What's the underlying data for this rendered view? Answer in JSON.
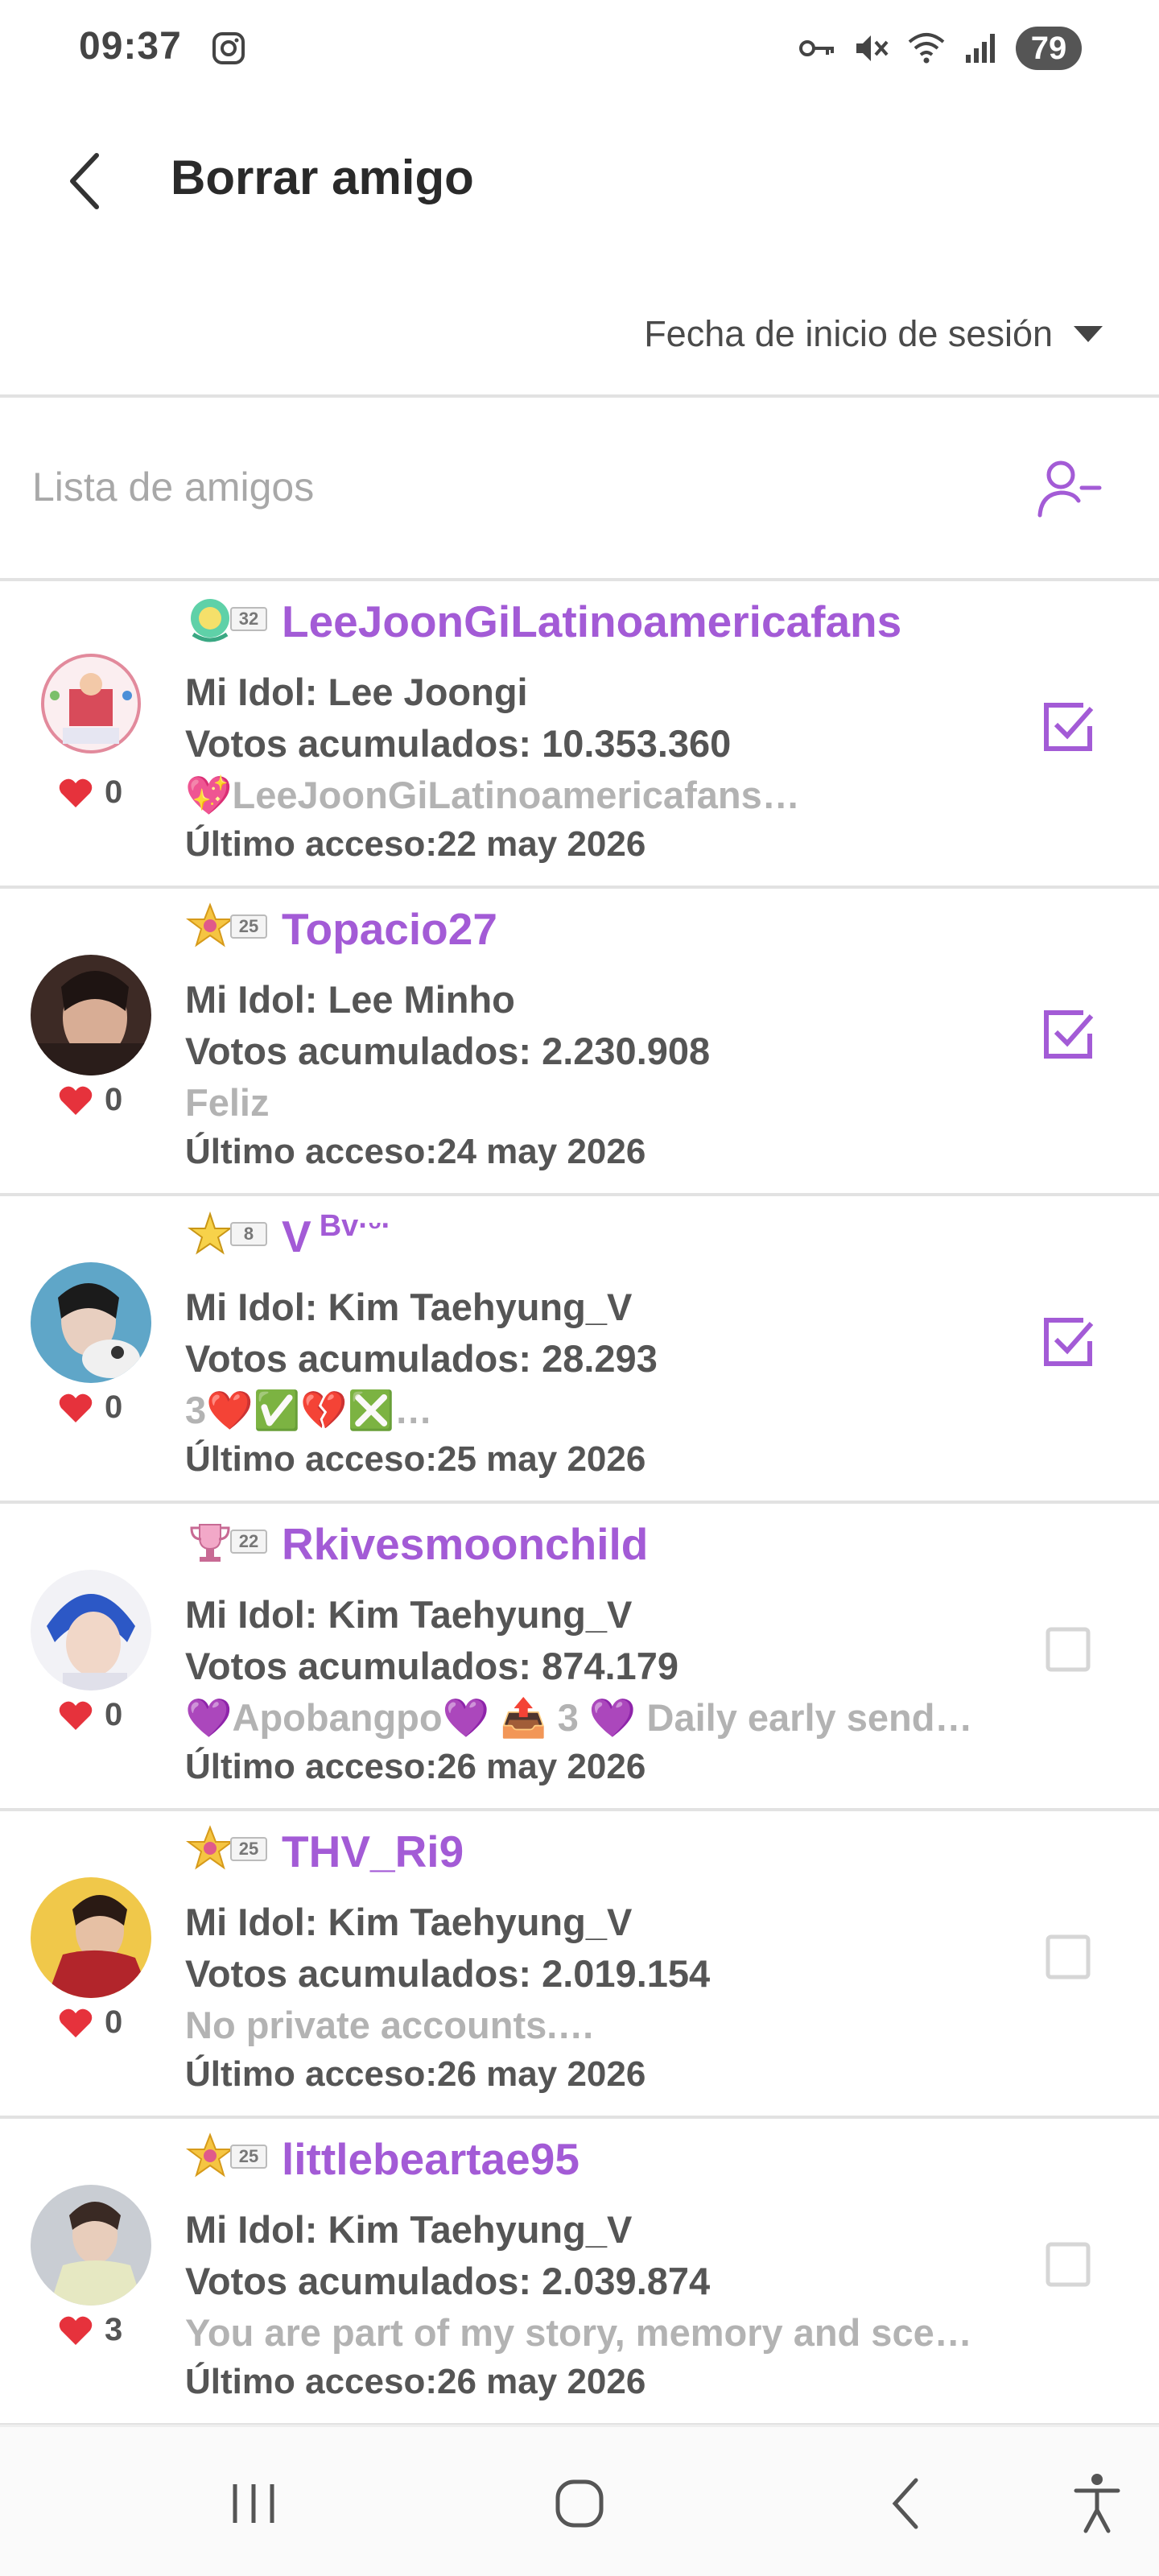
{
  "status_bar": {
    "time": "09:37",
    "battery": "79",
    "icons": [
      "instagram-icon",
      "vpn-key-icon",
      "mute-icon",
      "wifi-icon",
      "signal-icon"
    ]
  },
  "header": {
    "title": "Borrar amigo"
  },
  "sort": {
    "label": "Fecha de inicio de sesión"
  },
  "list": {
    "title": "Lista de amigos"
  },
  "friends": [
    {
      "badge_level": "32",
      "username": "LeeJoonGiLatinoamericafans",
      "username_suffix": "",
      "idol": "Mi Idol: Lee Joongi",
      "votes": "Votos acumulados: 10.353.360",
      "status": "💖LeeJoonGiLatinoamericafans…",
      "last_access": "Último acceso:22 may 2026",
      "likes": "0",
      "checked": true
    },
    {
      "badge_level": "25",
      "username": "Topacio27",
      "username_suffix": "",
      "idol": "Mi Idol: Lee Minho",
      "votes": "Votos acumulados: 2.230.908",
      "status": "Feliz",
      "last_access": "Último acceso:24 may 2026",
      "likes": "0",
      "checked": true
    },
    {
      "badge_level": "8",
      "username": "V",
      "username_suffix": "Bv·ᵕ·",
      "idol": "Mi Idol: Kim Taehyung_V",
      "votes": "Votos acumulados: 28.293",
      "status": "3❤️✅💔❎…",
      "last_access": "Último acceso:25 may 2026",
      "likes": "0",
      "checked": true
    },
    {
      "badge_level": "22",
      "username": "Rkivesmoonchild",
      "username_suffix": "",
      "idol": "Mi Idol: Kim Taehyung_V",
      "votes": "Votos acumulados: 874.179",
      "status": "💜Apobangpo💜 📤 3 💜 Daily early send…",
      "last_access": "Último acceso:26 may 2026",
      "likes": "0",
      "checked": false
    },
    {
      "badge_level": "25",
      "username": "THV_Ri9",
      "username_suffix": "",
      "idol": "Mi Idol: Kim Taehyung_V",
      "votes": "Votos acumulados: 2.019.154",
      "status": "No private accounts.…",
      "last_access": "Último acceso:26 may 2026",
      "likes": "0",
      "checked": false
    },
    {
      "badge_level": "25",
      "username": "littlebeartae95",
      "username_suffix": "",
      "idol": "Mi Idol: Kim Taehyung_V",
      "votes": "Votos acumulados: 2.039.874",
      "status": "You are part of my story, memory and sce…",
      "last_access": "Último acceso:26 may 2026",
      "likes": "3",
      "checked": false
    }
  ],
  "colors": {
    "accent": "#a35bd6",
    "heart": "#e6323c",
    "divider": "#e2e2e2"
  }
}
